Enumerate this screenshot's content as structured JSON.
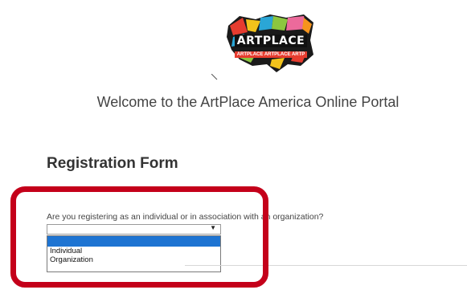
{
  "logo": {
    "text": "ARTPLACE",
    "banner_text": "ARTPLACE ARTPLACE ARTP"
  },
  "welcome_text": "Welcome to the ArtPlace America Online Portal",
  "form": {
    "heading": "Registration Form",
    "question": "Are you registering as an individual or in association with an organization?",
    "select": {
      "selected": "",
      "options": [
        "",
        "Individual",
        "Organization"
      ]
    }
  },
  "colors": {
    "highlight": "#c4001a",
    "option_selected": "#1e74d2"
  }
}
